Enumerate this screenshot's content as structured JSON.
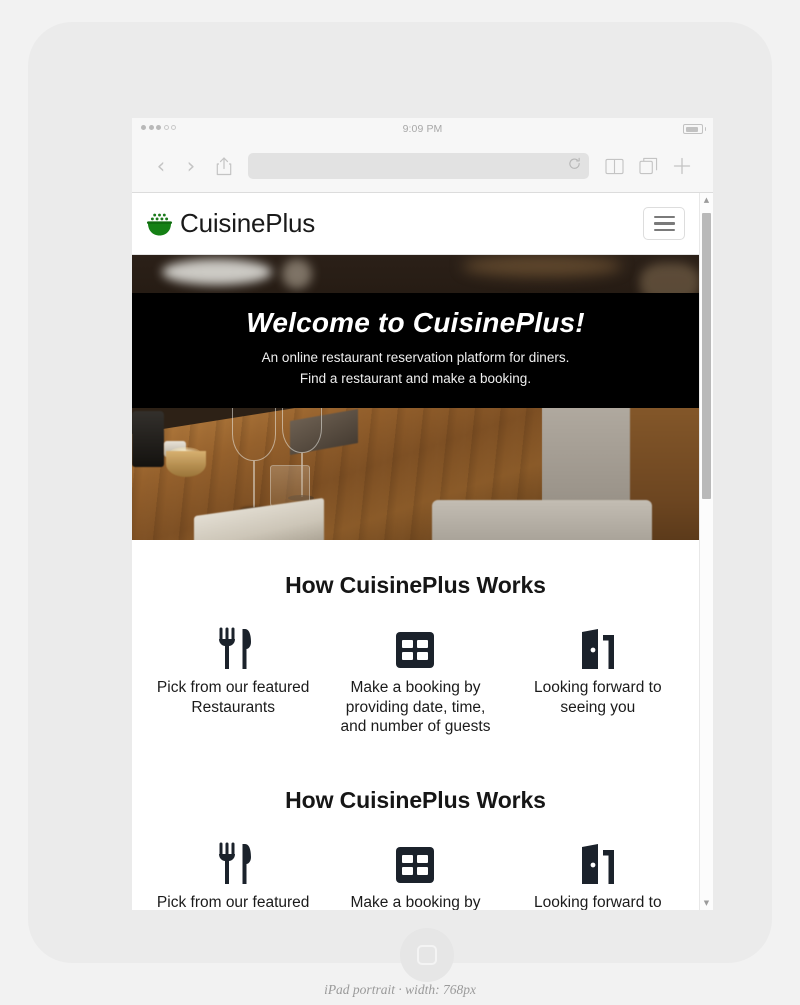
{
  "device": {
    "caption": "iPad portrait · width: 768px",
    "home_button_icon": "rounded-square-icon"
  },
  "browser": {
    "status": {
      "time": "9:09 PM",
      "signal_dots_filled": 3,
      "signal_dots_total": 5,
      "battery_icon": "battery-icon"
    },
    "toolbar": {
      "back_icon": "‹",
      "forward_icon": "›",
      "share_icon": "share-icon",
      "url_value": "",
      "url_placeholder": "",
      "reload_icon": "↻",
      "bookmarks_icon": "book-icon",
      "tabs_icon": "tabs-icon",
      "new_tab_icon": "＋"
    }
  },
  "site": {
    "navbar": {
      "logo_icon": "rice-bowl-icon",
      "brand": "CuisinePlus",
      "menu_button_icon": "hamburger-icon"
    },
    "hero": {
      "title": "Welcome to CuisinePlus!",
      "subtitle_line1": "An online restaurant reservation platform for diners.",
      "subtitle_line2": "Find a restaurant and make a booking.",
      "background_alt": "restaurant-interior-photo"
    },
    "sections": [
      {
        "heading": "How CuisinePlus Works",
        "features": [
          {
            "icon": "fork-knife-icon",
            "text": "Pick from our featured Restaurants"
          },
          {
            "icon": "calendar-grid-icon",
            "text": "Make a booking by providing date, time, and number of guests"
          },
          {
            "icon": "open-door-icon",
            "text": "Looking forward to seeing you"
          }
        ]
      },
      {
        "heading": "How CuisinePlus Works",
        "features": [
          {
            "icon": "fork-knife-icon",
            "text": "Pick from our featured Restaurants"
          },
          {
            "icon": "calendar-grid-icon",
            "text": "Make a booking by providing date, time, and number of guests"
          },
          {
            "icon": "open-door-icon",
            "text": "Looking forward to seeing you"
          }
        ]
      }
    ],
    "scrollbar": {
      "up_arrow": "▲",
      "down_arrow": "▼"
    }
  },
  "colors": {
    "brand_green": "#1a7a1a",
    "banner_background": "#000000",
    "icon_dark": "#1b222b",
    "page_background": "#ffffff",
    "device_frame": "#ebebeb"
  }
}
